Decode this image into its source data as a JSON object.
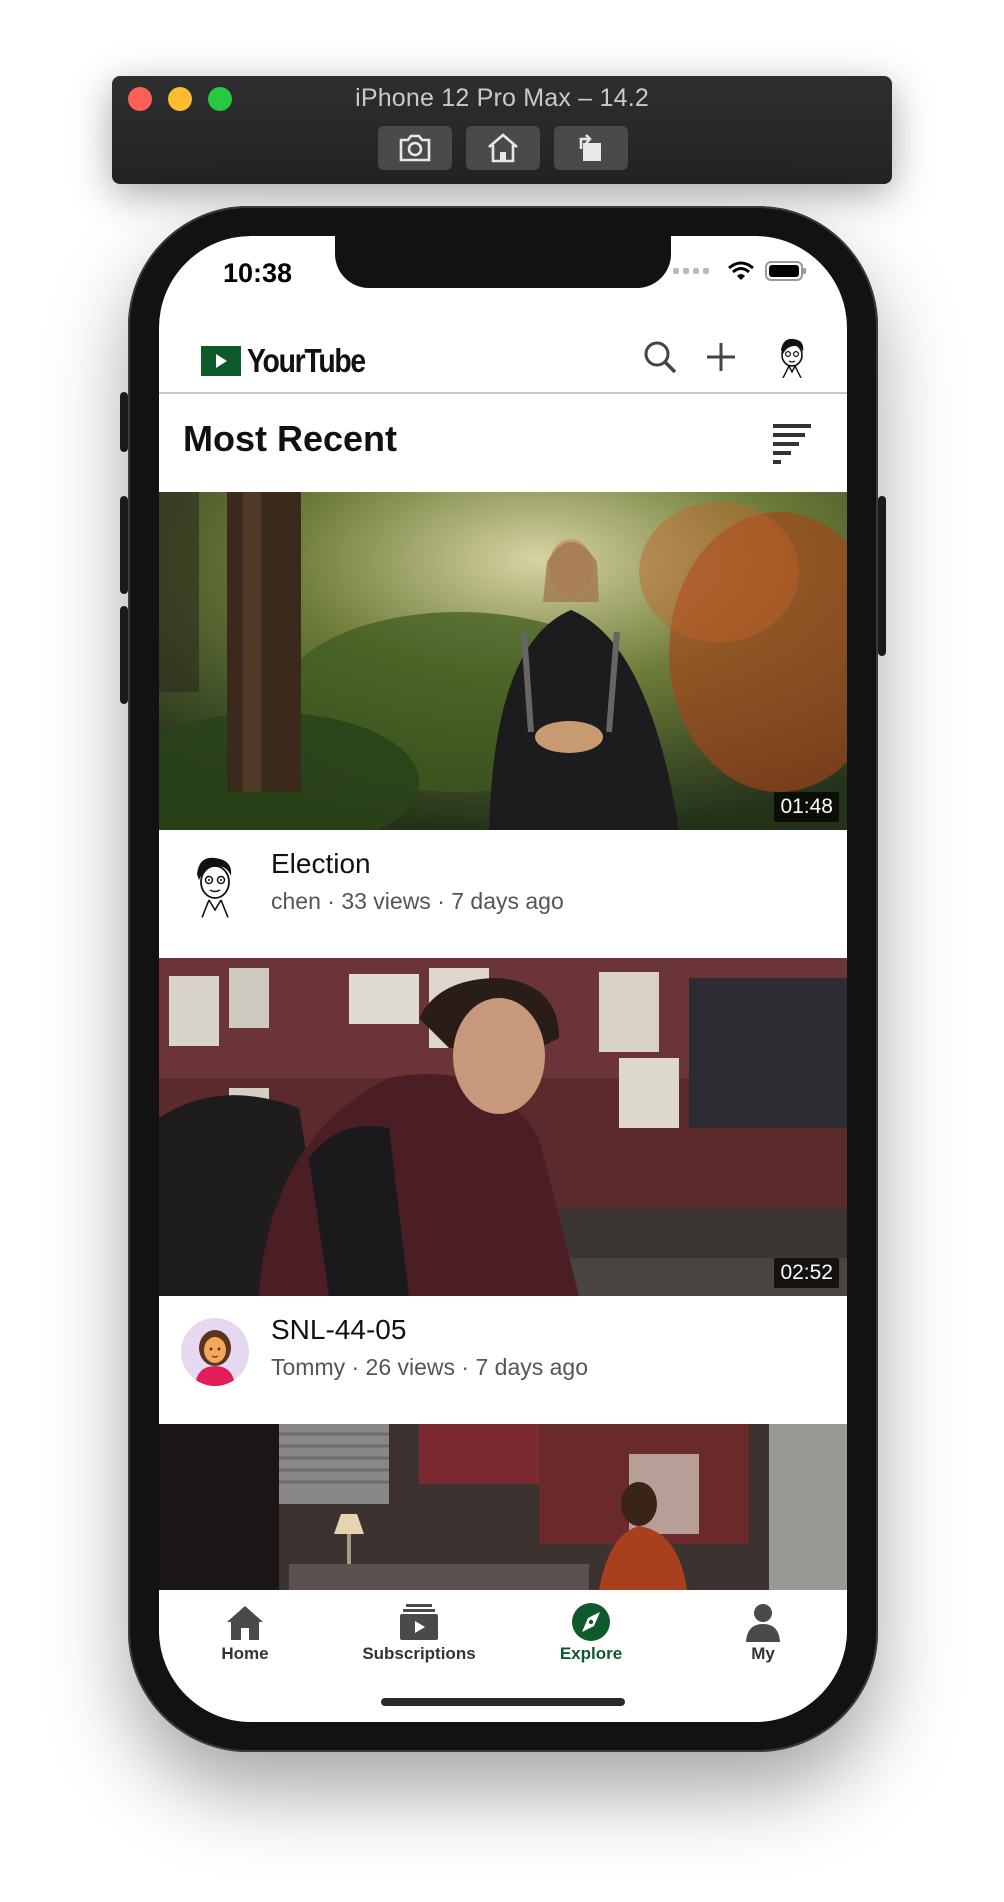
{
  "simulator": {
    "title": "iPhone 12 Pro Max – 14.2",
    "buttons": [
      "screenshot",
      "home",
      "rotate"
    ]
  },
  "status_bar": {
    "time": "10:38"
  },
  "app": {
    "name": "YourTube",
    "brand_color": "#0f5a2a",
    "header_icons": [
      "search-icon",
      "plus-icon",
      "profile-avatar"
    ]
  },
  "section": {
    "title": "Most Recent"
  },
  "videos": [
    {
      "title": "Election",
      "subtitle": "chen · 33 views · 7 days ago",
      "duration": "01:48",
      "avatar": "sketch-face"
    },
    {
      "title": "SNL-44-05",
      "subtitle": "Tommy · 26 views · 7 days ago",
      "duration": "02:52",
      "avatar": "woman-emoji"
    },
    {
      "title": "",
      "subtitle": "",
      "duration": "",
      "avatar": ""
    }
  ],
  "tabs": [
    {
      "label": "Home",
      "icon": "home-icon",
      "active": false
    },
    {
      "label": "Subscriptions",
      "icon": "subscriptions-icon",
      "active": false
    },
    {
      "label": "Explore",
      "icon": "compass-icon",
      "active": true
    },
    {
      "label": "My",
      "icon": "person-icon",
      "active": false
    }
  ]
}
